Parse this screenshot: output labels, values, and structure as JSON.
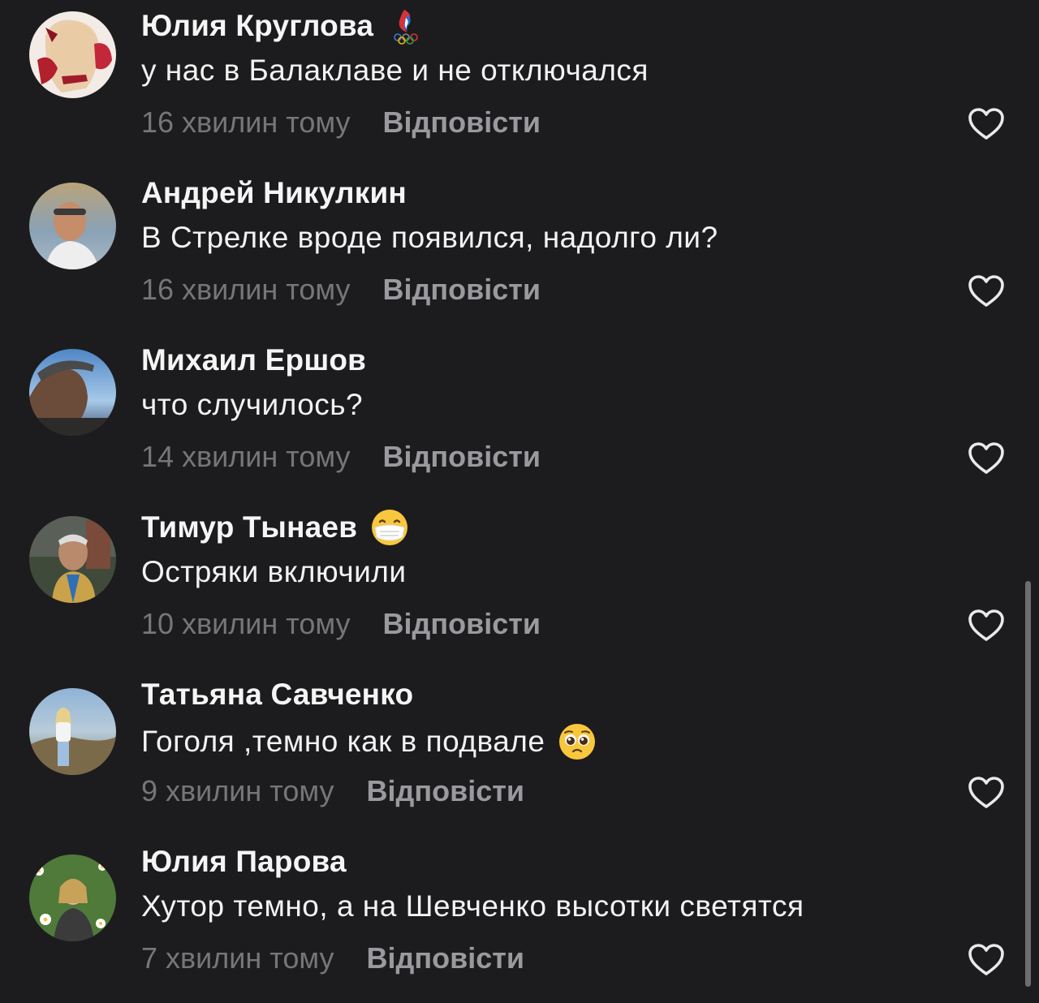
{
  "comments": [
    {
      "author": "Юлия Круглова",
      "badge": "olympic-flame-emoji",
      "text": "у нас в Балаклаве и не отключался",
      "time": "16 хвилин тому",
      "reply_label": "Відповісти"
    },
    {
      "author": "Андрей Никулкин",
      "text": "В Стрелке вроде появился, надолго ли?",
      "time": "16 хвилин тому",
      "reply_label": "Відповісти"
    },
    {
      "author": "Михаил Ершов",
      "text": "что случилось?",
      "time": "14 хвилин тому",
      "reply_label": "Відповісти"
    },
    {
      "author": "Тимур Тынаев",
      "badge": "face-with-medical-mask-emoji",
      "text": "Остряки включили",
      "time": "10 хвилин тому",
      "reply_label": "Відповісти"
    },
    {
      "author": "Татьяна Савченко",
      "text": "Гоголя ,темно как в подвале",
      "text_emoji": "pleading-face-emoji",
      "time": "9 хвилин тому",
      "reply_label": "Відповісти"
    },
    {
      "author": "Юлия Парова",
      "text": "Хутор темно, а на Шевченко высотки светятся",
      "time": "7 хвилин тому",
      "reply_label": "Відповісти"
    }
  ],
  "icons": {
    "like": "heart-outline-icon"
  },
  "colors": {
    "background": "#1c1c1e",
    "author": "#f5f5f5",
    "time": "#76767a",
    "reply": "#9a9a9e"
  }
}
